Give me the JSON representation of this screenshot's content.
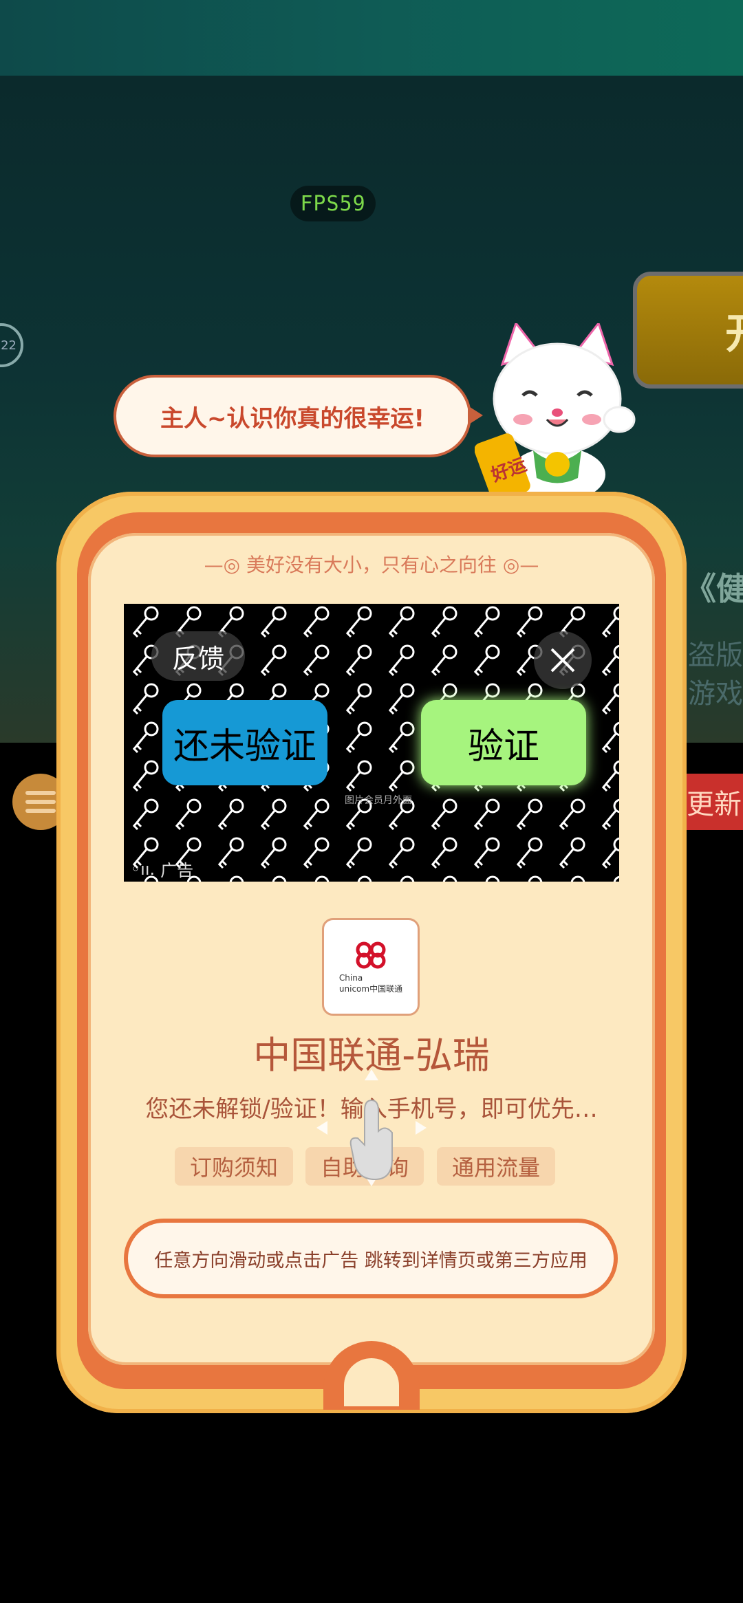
{
  "overlay": {
    "fps": "FPS59"
  },
  "background": {
    "left_badge": "22",
    "right_banner": "开",
    "right_text_1": "《健",
    "right_text_2": "盗版游\n游戏信",
    "left_circle_icon": "list-icon",
    "right_button": "更新"
  },
  "mascot": {
    "speech": "主人~认识你真的很幸运!",
    "cat_badge": "好运"
  },
  "popup": {
    "motto": "美好没有大小，只有心之向往",
    "ad": {
      "feedback_label": "反馈",
      "close_icon": "close-icon",
      "button_left": "还未验证",
      "button_right": "验证",
      "caption": "图片会员月外面",
      "ad_tag": "广告"
    },
    "logo": {
      "line1": "China",
      "line2": "unicom中国联通"
    },
    "app_title": "中国联通-弘瑞",
    "description": "您还未解锁/验证！输入手机号，即可优先…",
    "tags": [
      "订购须知",
      "自助查询",
      "通用流量"
    ],
    "cta_text": "任意方向滑动或点击广告 跳转到详情页或第三方应用"
  },
  "colors": {
    "frame_outer": "#f7c865",
    "frame_mid": "#e8763f",
    "frame_inner": "#fde9c1",
    "ad_button_left": "#1699d5",
    "ad_button_right": "#a6f47e",
    "fps_text": "#7dd94a"
  }
}
